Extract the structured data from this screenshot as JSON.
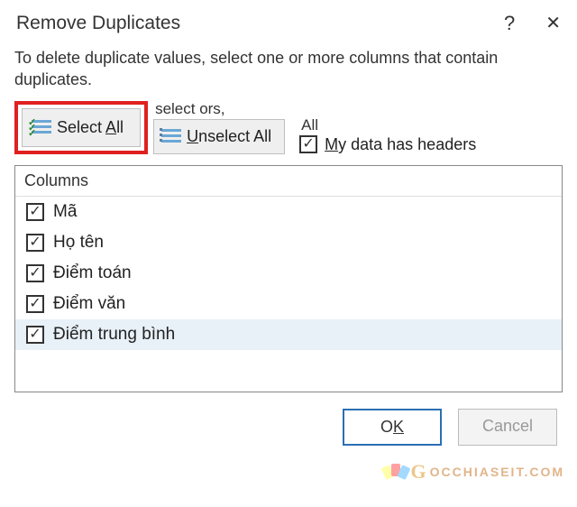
{
  "titlebar": {
    "title": "Remove Duplicates",
    "help_glyph": "?",
    "close_glyph": "✕"
  },
  "instructions": "To delete duplicate values, select one or more columns that contain duplicates.",
  "toolbar": {
    "select_all": {
      "prefix": "Select ",
      "accel": "A",
      "suffix": "ll"
    },
    "unselect_caption": "select ors,",
    "unselect_all": {
      "prefix": "",
      "accel": "U",
      "suffix": "nselect All"
    },
    "headers_caption": "All",
    "headers": {
      "accel": "M",
      "suffix": "y data has headers",
      "checked": true
    }
  },
  "columns": {
    "header": "Columns",
    "items": [
      {
        "label": "Mã",
        "checked": true,
        "selected": false
      },
      {
        "label": "Họ tên",
        "checked": true,
        "selected": false
      },
      {
        "label": "Điểm toán",
        "checked": true,
        "selected": false
      },
      {
        "label": "Điểm văn",
        "checked": true,
        "selected": false
      },
      {
        "label": "Điểm trung bình",
        "checked": true,
        "selected": true
      }
    ]
  },
  "footer": {
    "ok": {
      "prefix": "O",
      "accel": "K",
      "suffix": ""
    },
    "cancel": "Cancel"
  },
  "watermark": {
    "g": "G",
    "text": "OCCHIASEIT.COM"
  }
}
